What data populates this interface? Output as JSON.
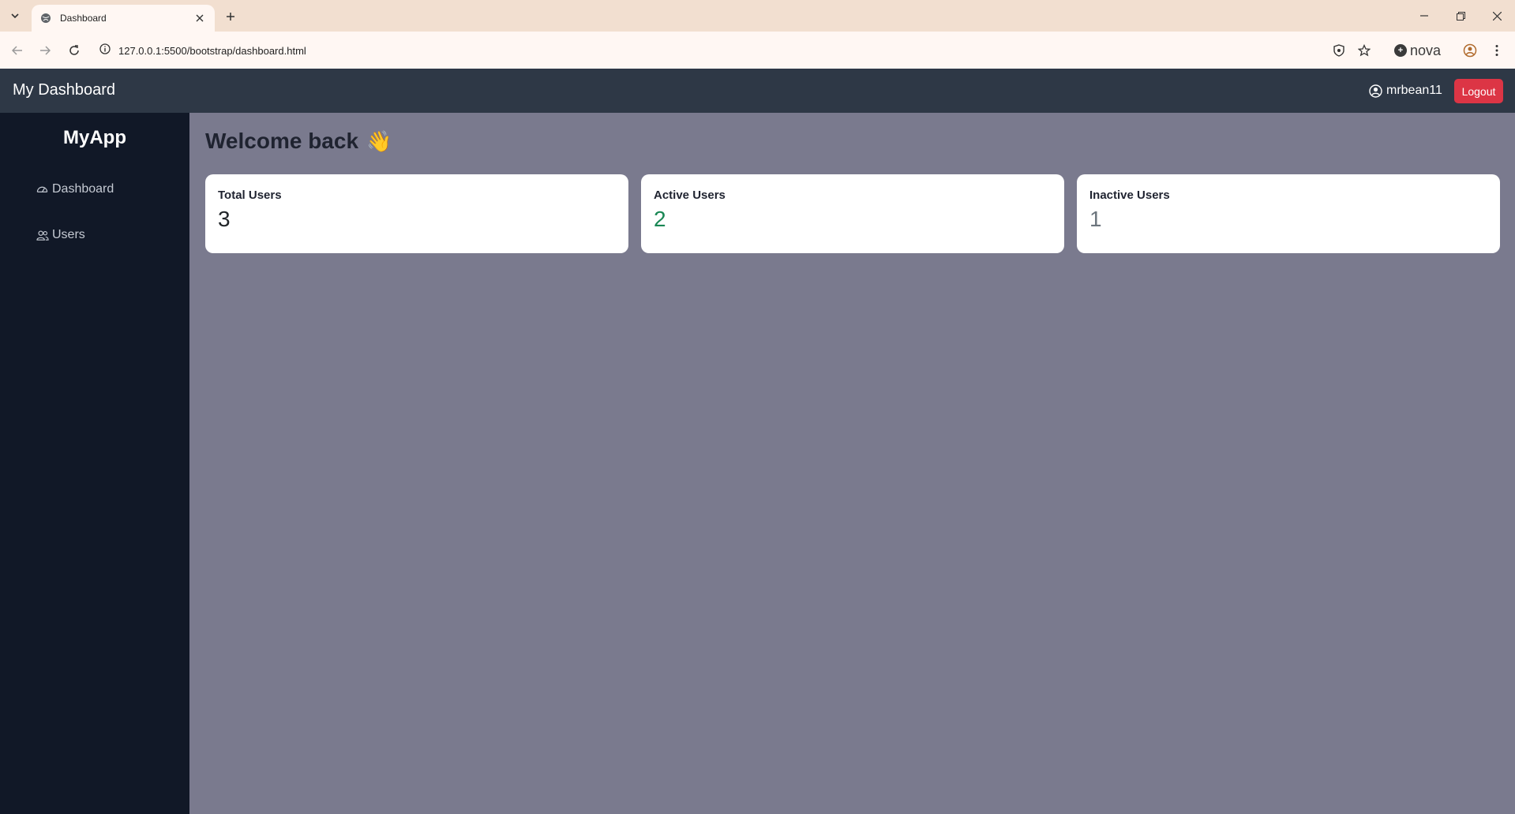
{
  "browser": {
    "tab_title": "Dashboard",
    "url": "127.0.0.1:5500/bootstrap/dashboard.html",
    "profile_label": "nova"
  },
  "header": {
    "brand": "My Dashboard",
    "username": "mrbean11",
    "logout_label": "Logout"
  },
  "sidebar": {
    "app_name": "MyApp",
    "items": [
      {
        "label": "Dashboard",
        "icon": "speedometer-icon"
      },
      {
        "label": "Users",
        "icon": "users-icon"
      }
    ]
  },
  "main": {
    "welcome": "Welcome back",
    "welcome_emoji": "👋",
    "cards": [
      {
        "label": "Total Users",
        "value": "3",
        "color": "#212529"
      },
      {
        "label": "Active Users",
        "value": "2",
        "color": "#198754"
      },
      {
        "label": "Inactive Users",
        "value": "1",
        "color": "#6c757d"
      }
    ]
  },
  "colors": {
    "header_bg": "#2e3846",
    "sidebar_bg": "#111827",
    "main_bg": "#7a7a8e",
    "logout_bg": "#dc3545"
  }
}
